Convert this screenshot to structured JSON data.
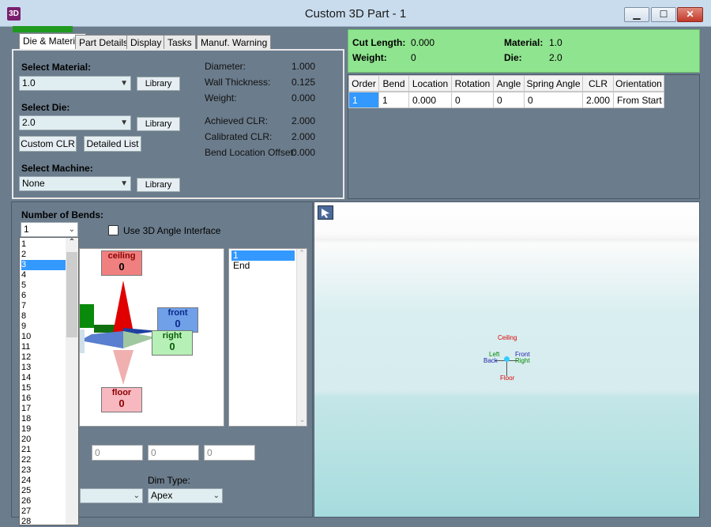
{
  "window": {
    "title": "Custom 3D Part - 1",
    "app_icon": "3D",
    "min": "▁",
    "max": "☐",
    "close": "✕"
  },
  "tabs": [
    "Die & Material",
    "Part Details",
    "Display",
    "Tasks",
    "Manuf. Warning"
  ],
  "material": {
    "select_material_label": "Select Material:",
    "material_value": "1.0",
    "library_label": "Library",
    "select_die_label": "Select Die:",
    "die_value": "2.0",
    "custom_clr_label": "Custom CLR",
    "detailed_list_label": "Detailed List",
    "select_machine_label": "Select Machine:",
    "machine_value": "None",
    "props": [
      {
        "label": "Diameter:",
        "value": "1.000"
      },
      {
        "label": "Wall Thickness:",
        "value": "0.125"
      },
      {
        "label": "Weight:",
        "value": "0.000"
      },
      {
        "label": "Achieved CLR:",
        "value": "2.000"
      },
      {
        "label": "Calibrated CLR:",
        "value": "2.000"
      },
      {
        "label": "Bend Location Offset:",
        "value": "0.000"
      }
    ]
  },
  "summary": {
    "cut_length_label": "Cut Length:",
    "cut_length": "0.000",
    "weight_label": "Weight:",
    "weight": "0",
    "material_label": "Material:",
    "material": "1.0",
    "die_label": "Die:",
    "die": "2.0"
  },
  "table": {
    "columns": [
      "Order",
      "Bend",
      "Location",
      "Rotation",
      "Angle",
      "Spring Angle",
      "CLR",
      "Orientation"
    ],
    "rows": [
      [
        "1",
        "1",
        "0.000",
        "0",
        "0",
        "0",
        "2.000",
        "From Start"
      ]
    ]
  },
  "bends": {
    "number_label": "Number of Bends:",
    "number_value": "1",
    "use_3d_label": "Use 3D Angle Interface",
    "options": [
      "1",
      "2",
      "3",
      "4",
      "5",
      "6",
      "7",
      "8",
      "9",
      "10",
      "11",
      "12",
      "13",
      "14",
      "15",
      "16",
      "17",
      "18",
      "19",
      "20",
      "21",
      "22",
      "23",
      "24",
      "25",
      "26",
      "27",
      "28"
    ],
    "highlighted": "3",
    "list_items": [
      "1",
      "End"
    ],
    "inputs": [
      "0",
      "0",
      "0"
    ],
    "dim_type_label": "Dim Type:",
    "dim_type_value": "Apex"
  },
  "compass": {
    "ceiling": "ceiling",
    "ceiling_val": "0",
    "front": "front",
    "front_val": "0",
    "right": "right",
    "right_val": "0",
    "floor": "floor",
    "floor_val": "0"
  },
  "view3d": {
    "ceiling": "Ceiling",
    "floor": "Floor",
    "front": "Front",
    "right": "Right",
    "left": "Left",
    "back": "Back"
  },
  "colors": {
    "panel": "#6b7c8c",
    "info_green": "#8fe48f",
    "select_blue": "#3399ff"
  }
}
